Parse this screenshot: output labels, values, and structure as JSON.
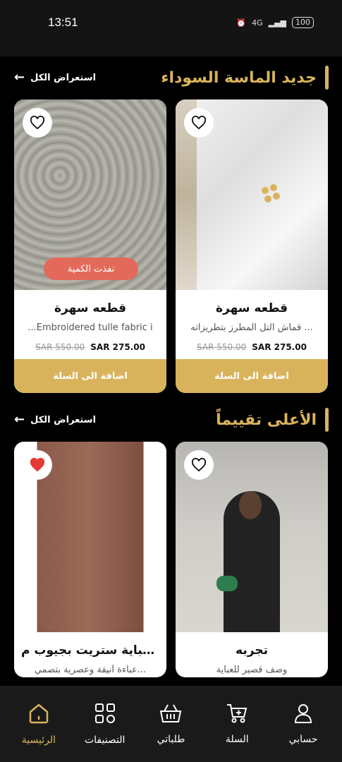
{
  "status": {
    "time": "13:51",
    "battery": "100",
    "network": "4G"
  },
  "sections": [
    {
      "title": "جديد الماسة السوداء",
      "view_all": "استعراض الكل",
      "products": [
        {
          "name": "قطعه سهرة",
          "desc": "قماش التل المطرز بتطريزاته ...",
          "old_price": "SAR 550.00",
          "price": "SAR 275.00",
          "add": "اضافة الى السلة",
          "favorite": false
        },
        {
          "name": "قطعه سهرة",
          "desc": "...Embroidered tulle fabric i",
          "old_price": "SAR 550.00",
          "price": "SAR 275.00",
          "add": "اضافة الى السلة",
          "badge": "نفذت الكمية",
          "favorite": false
        }
      ]
    },
    {
      "title": "الأعلى تقييماً",
      "view_all": "استعراض الكل",
      "products": [
        {
          "name": "تجربه",
          "desc": "وصف قصير للعباية",
          "favorite": false
        },
        {
          "name": "عباية ستريت بجيوب م...",
          "desc": "عباءة أنيقة وعصرية بتصمي...",
          "favorite": true
        }
      ]
    }
  ],
  "nav": [
    {
      "label": "حسابي",
      "icon": "user-icon"
    },
    {
      "label": "السلة",
      "icon": "cart-icon"
    },
    {
      "label": "طلباتي",
      "icon": "basket-icon"
    },
    {
      "label": "التصنيفات",
      "icon": "grid-icon"
    },
    {
      "label": "الرئيسية",
      "icon": "home-icon",
      "active": true
    }
  ],
  "colors": {
    "accent": "#d9b35b",
    "background": "#000000",
    "badge": "#e36a5a",
    "heart_active": "#e53935"
  }
}
